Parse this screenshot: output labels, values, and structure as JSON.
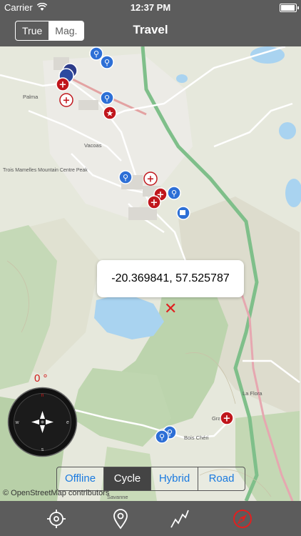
{
  "status": {
    "carrier": "Carrier",
    "time": "12:37 PM"
  },
  "nav": {
    "title": "Travel",
    "north_true": "True",
    "north_mag": "Mag."
  },
  "map": {
    "place_labels": [
      "Palma",
      "Vacoas",
      "Trois Mamelles Mountain Centre Peak",
      "La Flora",
      "Bois Chéri",
      "Gra",
      "Savanne"
    ],
    "callout_coords": "-20.369841, 57.525787",
    "heading": "0 °",
    "attribution": "© OpenStreetMap contributors"
  },
  "map_types": {
    "offline": "Offline",
    "cycle": "Cycle",
    "hybrid": "Hybrid",
    "road": "Road",
    "selected": "Cycle"
  },
  "compass": {
    "n": "n",
    "s": "s",
    "e": "e",
    "w": "w"
  },
  "toolbar": [
    "locate-icon",
    "pin-icon",
    "route-icon",
    "compass-icon"
  ]
}
